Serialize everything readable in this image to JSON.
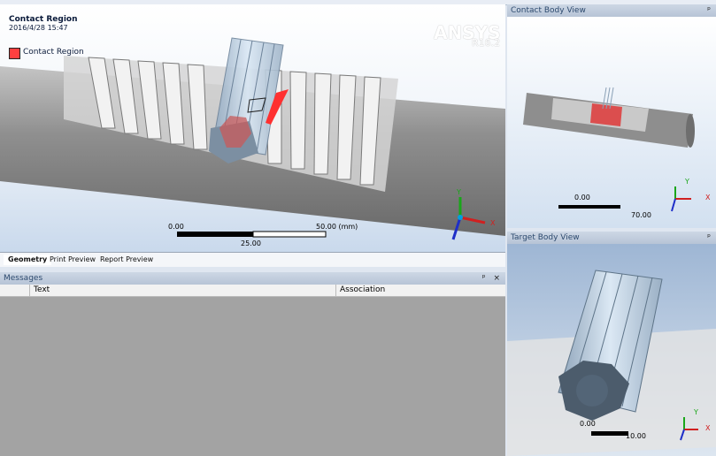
{
  "main_view": {
    "title": "Contact Region",
    "date": "2016/4/28 15:47",
    "legend_label": "Contact Region",
    "legend_color": "#ff4040",
    "brand": "ANSYS",
    "version": "R16.2",
    "scale": {
      "left": "0.00",
      "right": "50.00 (mm)",
      "mid": "25.00"
    },
    "triad": {
      "x": "X",
      "y": "Y"
    }
  },
  "tabs": [
    {
      "label": "Geometry",
      "active": true
    },
    {
      "label": "Print Preview",
      "active": false
    },
    {
      "label": "Report Preview",
      "active": false
    }
  ],
  "messages": {
    "title": "Messages",
    "pin": "ᵖ",
    "close": "×",
    "columns": [
      "Text",
      "Association"
    ]
  },
  "contact_body_view": {
    "title": "Contact Body View",
    "pin": "ᵖ",
    "scale": {
      "left": "0.00",
      "right": "70.00"
    },
    "triad": {
      "x": "X",
      "y": "Y"
    }
  },
  "target_body_view": {
    "title": "Target Body View",
    "pin": "ᵖ",
    "scale": {
      "left": "0.00",
      "right": "10.00"
    },
    "triad": {
      "x": "X",
      "y": "Y"
    }
  }
}
